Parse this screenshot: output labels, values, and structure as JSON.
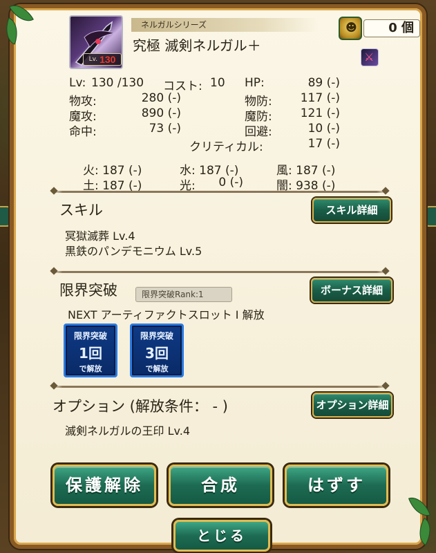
{
  "header": {
    "series": "ネルガルシリーズ",
    "item_name": "究極 滅剣ネルガル＋",
    "level_tag": "Lv.",
    "level_value": "130",
    "count": "0 個",
    "thumb_icon": "dark-sword-weapon-icon",
    "weapon_type_icon": "sword-type-icon"
  },
  "stats": {
    "lv_label": "Lv:",
    "lv_value": "130 /130",
    "cost_label": "コスト:",
    "cost_value": "10",
    "hp_label": "HP:",
    "hp_value": "89 (-)",
    "patk_label": "物攻:",
    "patk_value": "280 (-)",
    "pdef_label": "物防:",
    "pdef_value": "117 (-)",
    "matk_label": "魔攻:",
    "matk_value": "890 (-)",
    "mdef_label": "魔防:",
    "mdef_value": "121 (-)",
    "acc_label": "命中:",
    "acc_value": "73 (-)",
    "eva_label": "回避:",
    "eva_value": "10 (-)",
    "crit_label": "クリティカル:",
    "crit_value": "17 (-)"
  },
  "elements": {
    "fire": "火: 187 (-)",
    "water": "水: 187 (-)",
    "wind": "風: 187 (-)",
    "earth": "土: 187 (-)",
    "light": "光:",
    "light_value": "0 (-)",
    "dark": "闇: 938 (-)"
  },
  "skill": {
    "title": "スキル",
    "button": "スキル詳細",
    "lines": [
      "冥獄滅葬 Lv.4",
      "黒鉄のパンデモニウム Lv.5"
    ]
  },
  "limit": {
    "title": "限界突破",
    "rank": "限界突破Rank:1",
    "button": "ボーナス詳細",
    "next": "NEXT アーティファクトスロット Ⅰ 解放",
    "badges": [
      {
        "l1": "限界突破",
        "l2": "1回",
        "l3": "で解放"
      },
      {
        "l1": "限界突破",
        "l2": "3回",
        "l3": "で解放"
      }
    ]
  },
  "option": {
    "title": "オプション (解放条件： - )",
    "button": "オプション詳細",
    "line": "滅剣ネルガルの王印 Lv.4"
  },
  "actions": {
    "protect_release": "保護解除",
    "compose": "合成",
    "remove": "はずす",
    "close": "とじる"
  },
  "colors": {
    "panel_bg": "#f6efd8",
    "frame": "#8a5a24",
    "button_green": "#1d6b52",
    "button_border": "#e0bc52",
    "level_red": "#e8382a",
    "badge_blue": "#0e3a86"
  }
}
